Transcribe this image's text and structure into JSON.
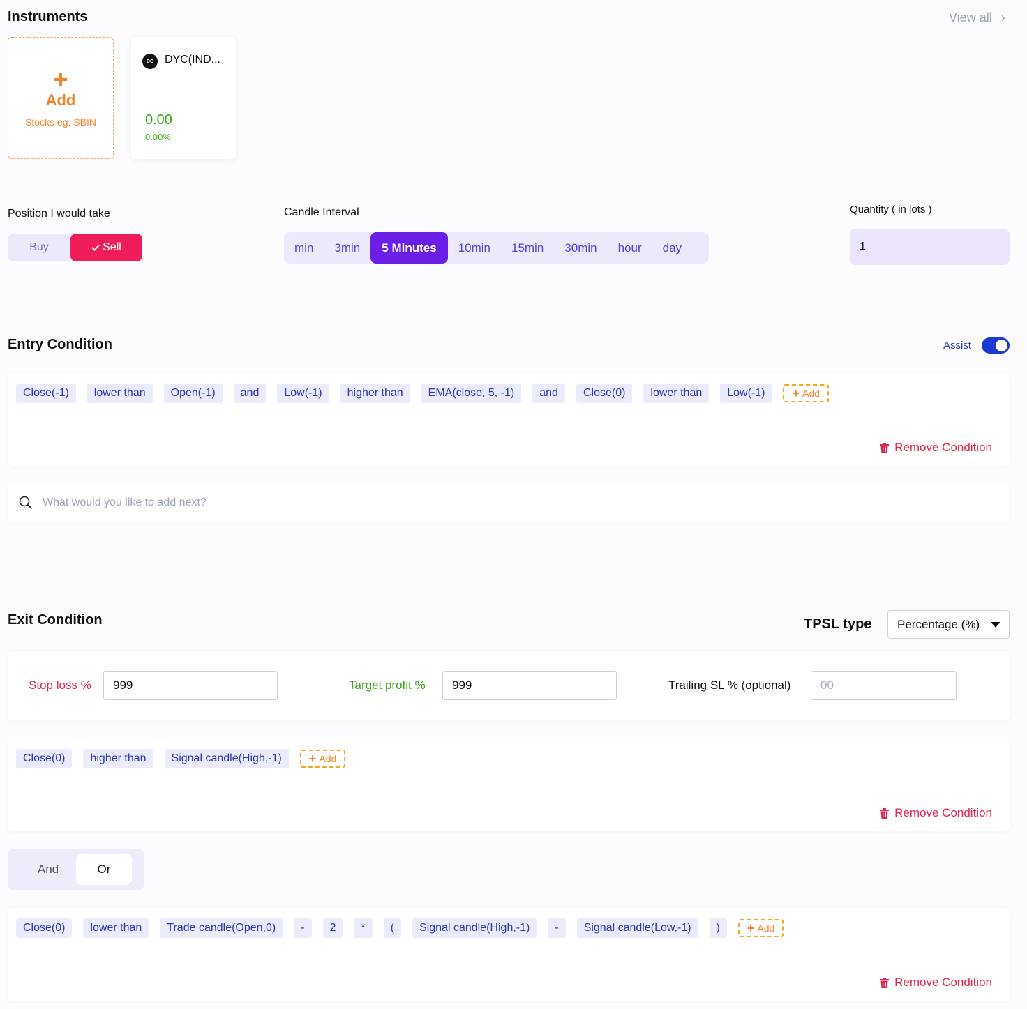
{
  "instruments": {
    "title": "Instruments",
    "view_all": "View all",
    "add_card": {
      "icon": "plus-icon",
      "label": "Add",
      "hint": "Stocks eg, SBIN"
    },
    "items": [
      {
        "logo": "DC",
        "name": "DYC(IND...",
        "price": "0.00",
        "change": "0.00%"
      }
    ]
  },
  "position": {
    "label": "Position I would take",
    "buy": "Buy",
    "sell": "Sell",
    "selected": "Sell"
  },
  "candle": {
    "label": "Candle Interval",
    "intervals": [
      "min",
      "3min",
      "5 Minutes",
      "10min",
      "15min",
      "30min",
      "hour",
      "day"
    ],
    "selected": "5 Minutes"
  },
  "quantity": {
    "label": "Quantity ( in lots )",
    "value": "1"
  },
  "entry": {
    "title": "Entry Condition",
    "assist_label": "Assist",
    "assist_on": true,
    "chips": [
      "Close(-1)",
      "lower than",
      "Open(-1)",
      "and",
      "Low(-1)",
      "higher than",
      "EMA(close, 5, -1)",
      "and",
      "Close(0)",
      "lower than",
      "Low(-1)"
    ],
    "add_label": "Add",
    "remove_label": "Remove Condition",
    "search_placeholder": "What would you like to add next?"
  },
  "exit": {
    "title": "Exit Condition",
    "tpsl_label": "TPSL type",
    "tpsl_value": "Percentage (%)",
    "stop_loss_label": "Stop loss %",
    "stop_loss_value": "999",
    "target_profit_label": "Target profit %",
    "target_profit_value": "999",
    "trailing_label": "Trailing SL % (optional)",
    "trailing_placeholder": "00",
    "condition1": {
      "chips": [
        "Close(0)",
        "higher than",
        "Signal candle(High,-1)"
      ],
      "add_label": "Add",
      "remove_label": "Remove Condition"
    },
    "logic": {
      "and": "And",
      "or": "Or",
      "selected": "Or"
    },
    "condition2": {
      "chips": [
        "Close(0)",
        "lower than",
        "Trade candle(Open,0)",
        "-",
        "2",
        "*",
        "(",
        "Signal candle(High,-1)",
        "-",
        "Signal candle(Low,-1)",
        ")"
      ],
      "add_label": "Add",
      "remove_label": "Remove Condition"
    }
  },
  "colors": {
    "accent_purple": "#6a1ee6",
    "sell_red": "#ef1d59",
    "add_orange": "#f5822a",
    "profit_green": "#3aa617",
    "chip_text": "#2b37b8"
  }
}
